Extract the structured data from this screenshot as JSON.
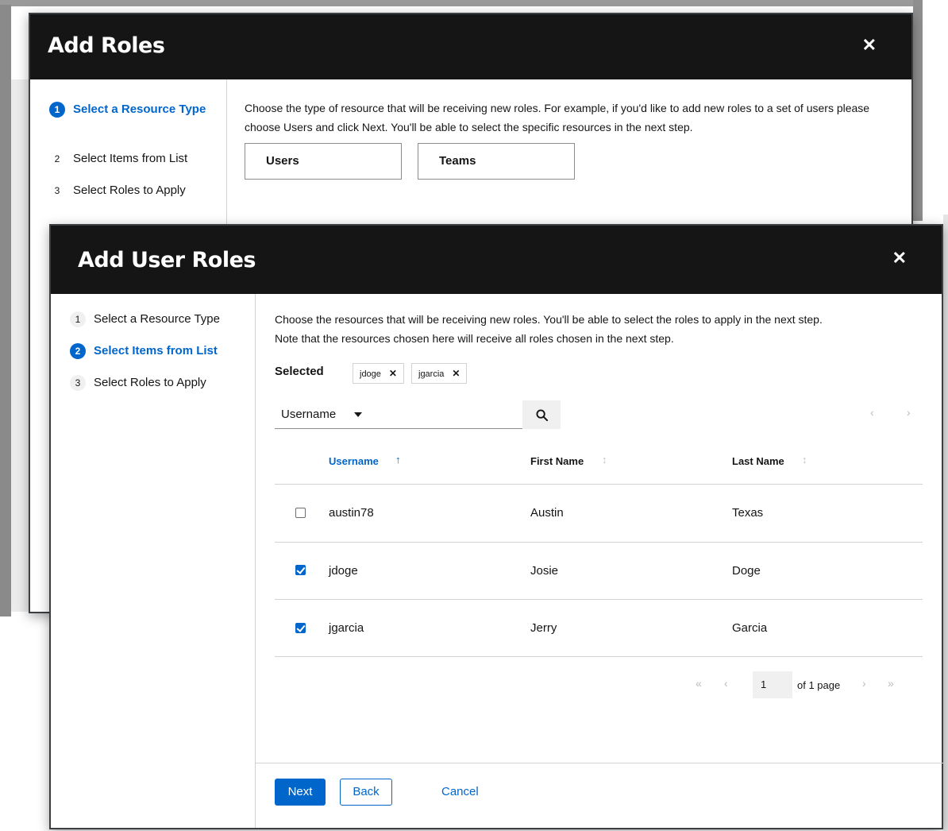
{
  "add_roles_modal": {
    "title": "Add Roles",
    "close_glyph": "✕",
    "steps": [
      {
        "num": "1",
        "label": "Select a Resource Type"
      },
      {
        "num": "2",
        "label": "Select Items from List"
      },
      {
        "num": "3",
        "label": "Select Roles to Apply"
      }
    ],
    "description": "Choose the type of resource that will be receiving new roles. For example, if you'd like to add new roles to a set of users please choose Users and click Next. You'll be able to select the specific resources in the next step.",
    "resource_types": [
      "Users",
      "Teams"
    ]
  },
  "add_user_roles_modal": {
    "title": "Add User Roles",
    "close_glyph": "✕",
    "steps": [
      {
        "num": "1",
        "label": "Select a Resource Type"
      },
      {
        "num": "2",
        "label": "Select Items from List"
      },
      {
        "num": "3",
        "label": "Select Roles to Apply"
      }
    ],
    "description_line1": "Choose the resources that will be receiving new roles. You'll be able to select the roles to apply in the next step.",
    "description_line2": "Note that the resources chosen here will receive all roles chosen in the next step.",
    "selected_label": "Selected",
    "selected_chips": [
      "jdoge",
      "jgarcia"
    ],
    "chip_remove_glyph": "✕",
    "filter_field": "Username",
    "search_value": "",
    "columns": [
      {
        "label": "Username",
        "sort_icon": "↑",
        "sorted": true
      },
      {
        "label": "First Name",
        "sort_icon": "↕",
        "sorted": false
      },
      {
        "label": "Last Name",
        "sort_icon": "↕",
        "sorted": false
      }
    ],
    "rows": [
      {
        "username": "austin78",
        "first_name": "Austin",
        "last_name": "Texas",
        "checked": false
      },
      {
        "username": "jdoge",
        "first_name": "Josie",
        "last_name": "Doge",
        "checked": true
      },
      {
        "username": "jgarcia",
        "first_name": "Jerry",
        "last_name": "Garcia",
        "checked": true
      }
    ],
    "pagination": {
      "prev_glyph": "‹",
      "next_glyph": "›",
      "first_glyph": "«",
      "last_glyph": "»",
      "current_page": "1",
      "of_pages": "of 1 page"
    },
    "buttons": {
      "next": "Next",
      "back": "Back",
      "cancel": "Cancel"
    }
  }
}
